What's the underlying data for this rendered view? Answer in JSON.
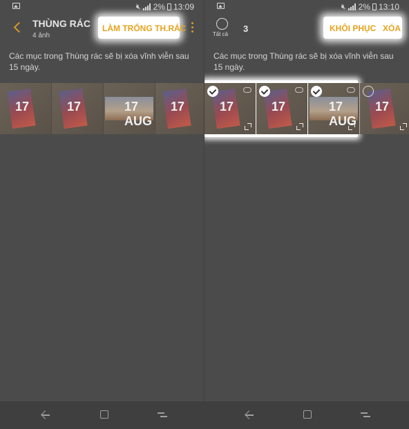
{
  "left": {
    "status": {
      "battery": "2%",
      "time": "13:09"
    },
    "header": {
      "title": "THÙNG RÁC",
      "subtitle": "4 ảnh",
      "empty_trash_label": "LÀM TRỐNG TH.RÁC"
    },
    "notice": "Các mục trong Thùng rác sẽ bị xóa vĩnh viễn sau 15 ngày.",
    "thumbs": [
      {
        "label": "17",
        "icon": "poster"
      },
      {
        "label": "17",
        "icon": "poster"
      },
      {
        "label": "17 AUG",
        "icon": "city"
      },
      {
        "label": "17",
        "icon": "poster"
      }
    ]
  },
  "right": {
    "status": {
      "battery": "2%",
      "time": "13:10"
    },
    "header": {
      "select_all_label": "Tất cả",
      "count": "3",
      "restore_label": "KHÔI PHỤC",
      "delete_label": "XÓA"
    },
    "notice": "Các mục trong Thùng rác sẽ bị xóa vĩnh viễn sau 15 ngày.",
    "thumbs": [
      {
        "label": "17",
        "selected": true
      },
      {
        "label": "17",
        "selected": true
      },
      {
        "label": "17 AUG",
        "selected": true
      },
      {
        "label": "17",
        "selected": false
      }
    ]
  },
  "colors": {
    "accent": "#e5a31d",
    "background": "#4b4b4b",
    "navbar": "#3f3f3f"
  },
  "icons": [
    "image-icon",
    "mute-icon",
    "signal-icon",
    "battery-icon",
    "back-icon",
    "more-icon",
    "select-all-icon",
    "check-icon",
    "cloud-icon",
    "expand-icon",
    "nav-back-icon",
    "nav-home-icon",
    "nav-recent-icon"
  ]
}
